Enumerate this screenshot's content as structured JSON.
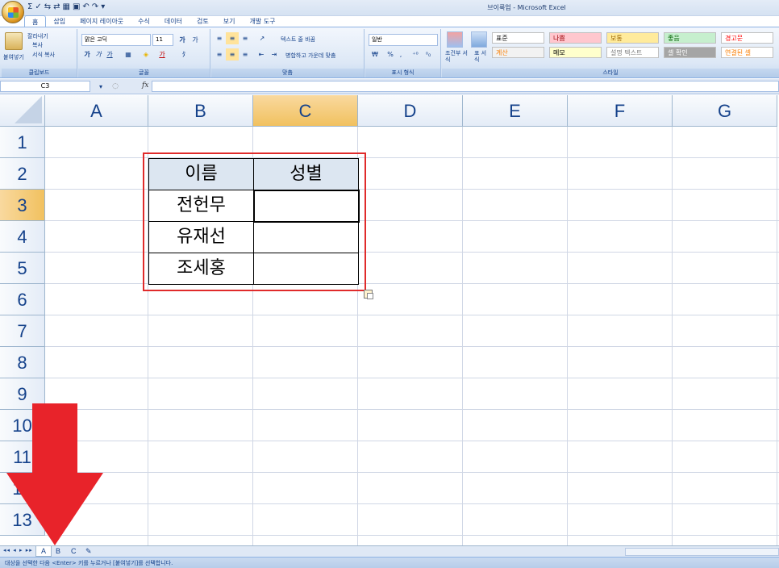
{
  "window": {
    "title": "브이룩업 - Microsoft Excel"
  },
  "quick_access": [
    "Σ",
    "✓",
    "⇆",
    "⇄",
    "▦",
    "▣",
    "↶",
    "↷",
    "▾"
  ],
  "ribbon": {
    "tabs": [
      "홈",
      "삽입",
      "페이지 레이아웃",
      "수식",
      "데이터",
      "검토",
      "보기",
      "개발 도구"
    ],
    "clipboard": {
      "paste": "붙여넣기",
      "cut": "잘라내기",
      "copy": "복사",
      "format_painter": "서식 복사",
      "label": "클립보드"
    },
    "font": {
      "name": "맑은 고딕",
      "size": "11",
      "bold": "가",
      "italic": "가",
      "underline": "가",
      "label": "글꼴"
    },
    "alignment": {
      "wrap": "텍스트 줄 바꿈",
      "merge": "병합하고 가운데 맞춤",
      "label": "맞춤"
    },
    "number": {
      "format": "일반",
      "currency": "₩",
      "percent": "%",
      "comma": ",",
      "label": "표시 형식"
    },
    "styles_buttons": {
      "conditional": "조건부 서식",
      "table": "표 서식"
    },
    "styles": {
      "cells": [
        {
          "text": "표준",
          "bg": "#ffffff",
          "color": "#000000"
        },
        {
          "text": "나쁨",
          "bg": "#ffc7ce",
          "color": "#9c0006"
        },
        {
          "text": "보통",
          "bg": "#ffeb9c",
          "color": "#9c6500"
        },
        {
          "text": "좋음",
          "bg": "#c6efce",
          "color": "#006100"
        },
        {
          "text": "경고문",
          "bg": "#ffffff",
          "color": "#ff0000"
        },
        {
          "text": "계산",
          "bg": "#f2f2f2",
          "color": "#fa7d00"
        },
        {
          "text": "메모",
          "bg": "#ffffcc",
          "color": "#000000"
        },
        {
          "text": "설명 텍스트",
          "bg": "#ffffff",
          "color": "#7f7f7f"
        },
        {
          "text": "셀 확인",
          "bg": "#a5a5a5",
          "color": "#ffffff"
        },
        {
          "text": "연결된 셀",
          "bg": "#ffffff",
          "color": "#fa7d00"
        }
      ],
      "label": "스타일"
    }
  },
  "formula_bar": {
    "name_box": "C3",
    "fx": "fx",
    "formula": ""
  },
  "columns": [
    "A",
    "B",
    "C",
    "D",
    "E",
    "F",
    "G"
  ],
  "selected_column": "C",
  "rows": [
    "1",
    "2",
    "3",
    "4",
    "5",
    "6",
    "7",
    "8",
    "9",
    "10",
    "11",
    "12",
    "13"
  ],
  "selected_row": "3",
  "table": {
    "headers": [
      "이름",
      "성별"
    ],
    "rows": [
      [
        "전헌무",
        ""
      ],
      [
        "유재선",
        ""
      ],
      [
        "조세홍",
        ""
      ]
    ]
  },
  "sheet_tabs": [
    "A",
    "B",
    "C"
  ],
  "active_sheet": "A",
  "status": "대상을 선택한 다음 <Enter> 키를 누르거나 [붙여넣기]를 선택합니다.",
  "colors": {
    "highlight": "#e02b2b",
    "header_fill": "#dce6f1",
    "selected_header": "#f1c15f"
  }
}
